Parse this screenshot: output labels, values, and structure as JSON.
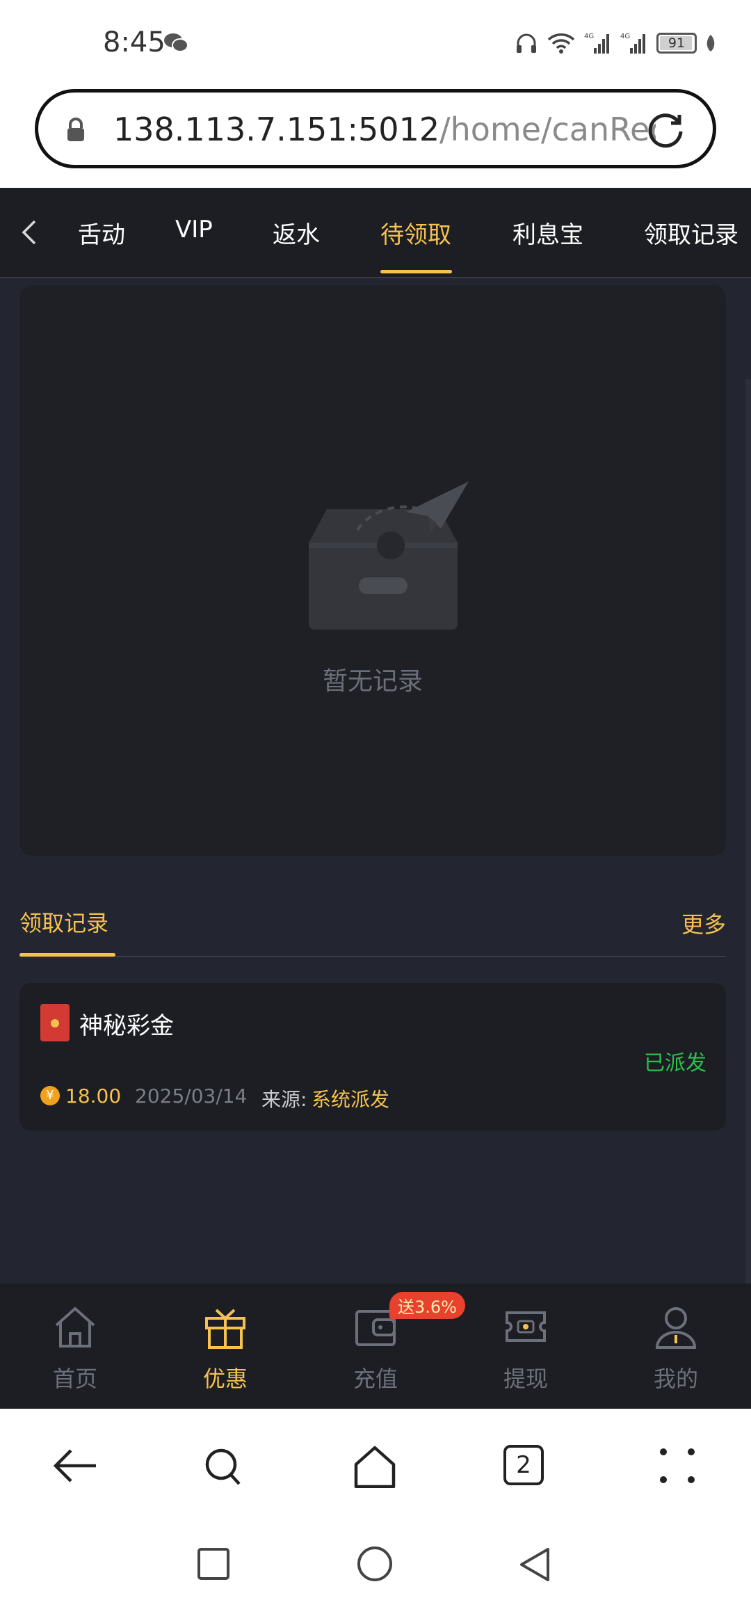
{
  "status_bar": {
    "time": "8:45",
    "battery": "91",
    "network_1": "4G",
    "network_2": "4G"
  },
  "address_bar": {
    "host": "138.113.7.151:5012",
    "path": "/home/canRec"
  },
  "tabs": {
    "items": [
      {
        "label": "活动",
        "shown": "舌动"
      },
      {
        "label": "VIP"
      },
      {
        "label": "返水"
      },
      {
        "label": "待领取"
      },
      {
        "label": "利息宝"
      },
      {
        "label": "领取记录"
      }
    ],
    "active": "待领取"
  },
  "empty_state": {
    "text": "暂无记录"
  },
  "records": {
    "title": "领取记录",
    "more": "更多",
    "items": [
      {
        "name": "神秘彩金",
        "status": "已派发",
        "amount": "18.00",
        "date": "2025/03/14",
        "source_label": "来源:",
        "source_value": "系统派发"
      }
    ]
  },
  "bottom_nav": {
    "items": [
      {
        "label": "首页",
        "icon": "home-icon"
      },
      {
        "label": "优惠",
        "icon": "gift-icon",
        "active": true
      },
      {
        "label": "充值",
        "icon": "wallet-icon",
        "badge": "送3.6%"
      },
      {
        "label": "提现",
        "icon": "cash-icon"
      },
      {
        "label": "我的",
        "icon": "user-icon"
      }
    ]
  },
  "browser_bar": {
    "tab_count": "2"
  },
  "colors": {
    "accent": "#f6c24e",
    "background": "#232630",
    "status_green": "#2fbf4c",
    "badge_red": "#e8412e"
  }
}
